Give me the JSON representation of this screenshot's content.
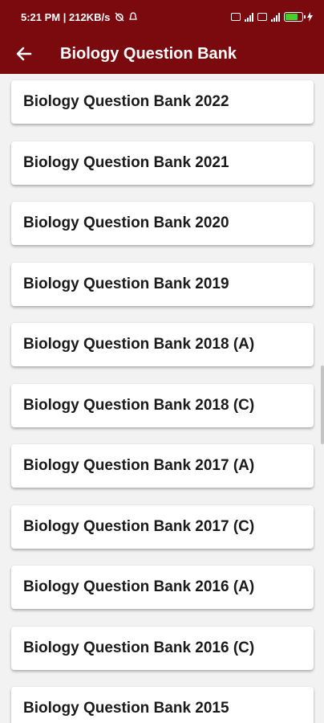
{
  "status_bar": {
    "time_speed": "5:21 PM | 212KB/s"
  },
  "header": {
    "title": "Biology Question Bank"
  },
  "question_banks": [
    {
      "label": "Biology Question Bank 2022"
    },
    {
      "label": "Biology Question Bank 2021"
    },
    {
      "label": "Biology Question Bank 2020"
    },
    {
      "label": "Biology Question Bank 2019"
    },
    {
      "label": "Biology Question Bank 2018 (A)"
    },
    {
      "label": "Biology Question Bank 2018 (C)"
    },
    {
      "label": "Biology Question Bank 2017 (A)"
    },
    {
      "label": "Biology Question Bank 2017 (C)"
    },
    {
      "label": "Biology Question Bank 2016 (A)"
    },
    {
      "label": "Biology Question Bank 2016 (C)"
    },
    {
      "label": "Biology Question Bank 2015"
    }
  ],
  "battery_level": 0.8,
  "colors": {
    "app_bar": "#7b0a0e",
    "background": "#f2f2f2",
    "card": "#ffffff",
    "text": "#1a1a1a",
    "battery": "#43d12f"
  },
  "icons": {
    "back": "arrow-left-icon"
  }
}
